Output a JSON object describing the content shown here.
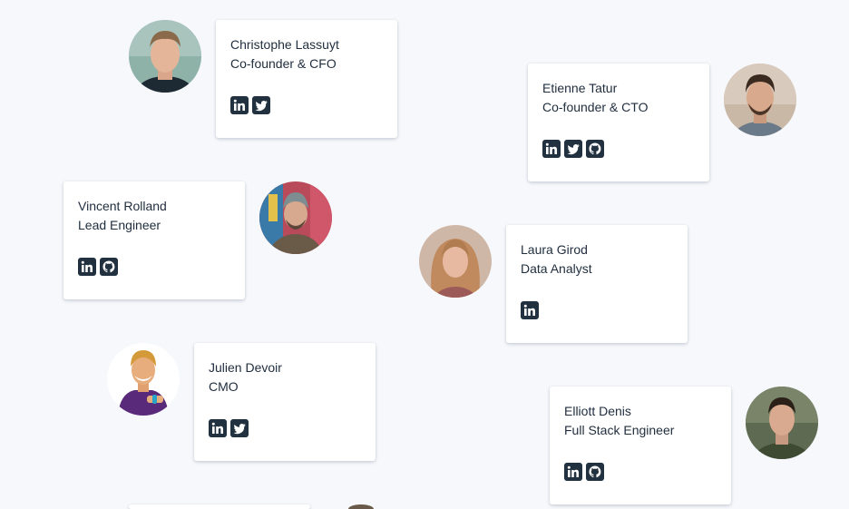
{
  "team": {
    "members": [
      {
        "name": "Christophe Lassuyt",
        "role": "Co-founder & CFO",
        "socials": [
          "linkedin-icon",
          "twitter-icon"
        ]
      },
      {
        "name": "Etienne Tatur",
        "role": "Co-founder & CTO",
        "socials": [
          "linkedin-icon",
          "twitter-icon",
          "github-icon"
        ]
      },
      {
        "name": "Vincent Rolland",
        "role": "Lead Engineer",
        "socials": [
          "linkedin-icon",
          "github-icon"
        ]
      },
      {
        "name": "Laura Girod",
        "role": "Data Analyst",
        "socials": [
          "linkedin-icon"
        ]
      },
      {
        "name": "Julien Devoir",
        "role": "CMO",
        "socials": [
          "linkedin-icon",
          "twitter-icon"
        ]
      },
      {
        "name": "Elliott Denis",
        "role": "Full Stack Engineer",
        "socials": [
          "linkedin-icon",
          "github-icon"
        ]
      }
    ]
  },
  "colors": {
    "page_background": "#f6f8fb",
    "card_background": "#ffffff",
    "text": "#1f2d3d",
    "icon_tile": "#22313f"
  }
}
